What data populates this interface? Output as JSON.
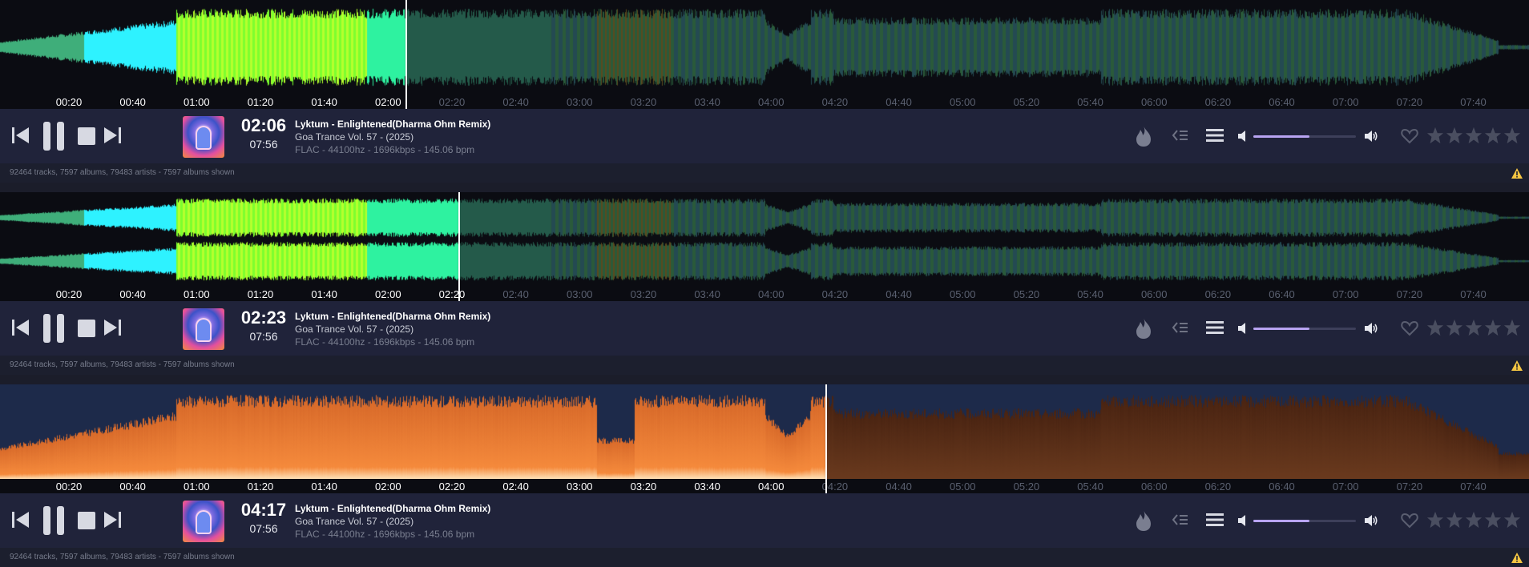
{
  "players": [
    {
      "id": "p1",
      "mode": "mono-waveform",
      "position": "02:06",
      "duration": "07:56",
      "progress": 0.265,
      "time_ticks": [
        "00:20",
        "00:40",
        "01:00",
        "01:20",
        "01:40",
        "02:00",
        "02:20",
        "02:40",
        "03:00",
        "03:20",
        "03:40",
        "04:00",
        "04:20",
        "04:40",
        "05:00",
        "05:20",
        "05:40",
        "06:00",
        "06:20",
        "06:40",
        "07:00",
        "07:20",
        "07:40"
      ],
      "track_line": "Lyktum - Enlightened(Dharma Ohm Remix)",
      "album_line": "Goa Trance Vol. 57 - (2025)",
      "format_line": "FLAC - 44100hz - 1696kbps - 145.06 bpm",
      "volume": 0.55,
      "status": "92464 tracks, 7597 albums, 79483 artists - 7597 albums shown"
    },
    {
      "id": "p2",
      "mode": "stereo-waveform",
      "position": "02:23",
      "duration": "07:56",
      "progress": 0.3,
      "time_ticks": [
        "00:20",
        "00:40",
        "01:00",
        "01:20",
        "01:40",
        "02:00",
        "02:20",
        "02:40",
        "03:00",
        "03:20",
        "03:40",
        "04:00",
        "04:20",
        "04:40",
        "05:00",
        "05:20",
        "05:40",
        "06:00",
        "06:20",
        "06:40",
        "07:00",
        "07:20",
        "07:40"
      ],
      "track_line": "Lyktum - Enlightened(Dharma Ohm Remix)",
      "album_line": "Goa Trance Vol. 57 - (2025)",
      "format_line": "FLAC - 44100hz - 1696kbps - 145.06 bpm",
      "volume": 0.55,
      "status": "92464 tracks, 7597 albums, 79483 artists - 7597 albums shown"
    },
    {
      "id": "p3",
      "mode": "spectrogram",
      "position": "04:17",
      "duration": "07:56",
      "progress": 0.54,
      "time_ticks": [
        "00:20",
        "00:40",
        "01:00",
        "01:20",
        "01:40",
        "02:00",
        "02:20",
        "02:40",
        "03:00",
        "03:20",
        "03:40",
        "04:00",
        "04:20",
        "04:40",
        "05:00",
        "05:20",
        "05:40",
        "06:00",
        "06:20",
        "06:40",
        "07:00",
        "07:20",
        "07:40"
      ],
      "track_line": "Lyktum - Enlightened(Dharma Ohm Remix)",
      "album_line": "Goa Trance Vol. 57 - (2025)",
      "format_line": "FLAC - 44100hz - 1696kbps - 145.06 bpm",
      "volume": 0.55,
      "status": "92464 tracks, 7597 albums, 79483 artists - 7597 albums shown"
    }
  ],
  "icons": {
    "prev": "skip-previous-icon",
    "pause": "pause-icon",
    "stop": "stop-icon",
    "next": "skip-next-icon",
    "flame": "flame-icon",
    "queue": "queue-icon",
    "menu": "menu-icon",
    "volume_low": "volume-low-icon",
    "volume_high": "volume-high-icon",
    "heart": "heart-icon",
    "star": "star-icon",
    "warning": "warning-icon"
  },
  "colors": {
    "background": "#1c1f2e",
    "waveform_bg": "#0b0c12",
    "accent_volume": "#b8a4f2",
    "spectrogram": "#f2823a",
    "waveform_green": "#7dff2e",
    "waveform_cyan": "#2ef2ff"
  },
  "rating": 0,
  "star_count": 5
}
